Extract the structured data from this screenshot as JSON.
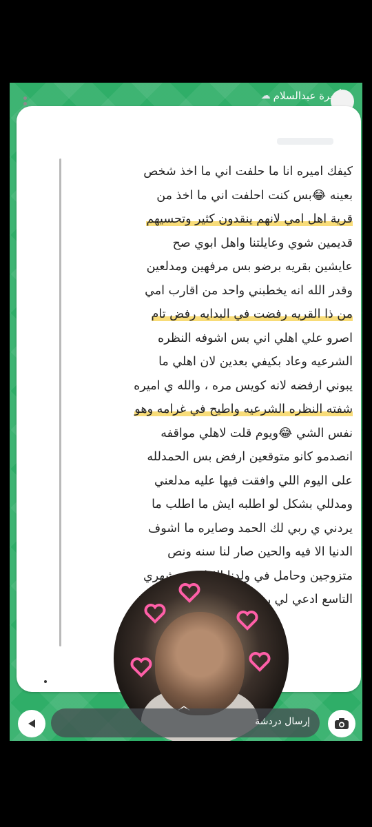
{
  "header": {
    "sender_name": "أميرة عبدالسلام",
    "sender_icon": "cloud-rain-icon"
  },
  "message": {
    "lines": [
      "كيفك اميره انا ما حلفت اني ما اخذ شخص",
      "بعينه 😂بس كنت احلفت اني ما اخذ من",
      "قرية اهل امي لانهم ينقدون كثير وتحسيهم",
      "قديمين شوي وعايلتنا واهل ابوي صح",
      "عايشين بقريه برضو بس مرفهين ومدلعين",
      "وقدر الله انه يخطبني واحد من اقارب امي",
      "من ذا القريه رفضت في البدايه رفض تام",
      "اصرو علي اهلي اني بس اشوفه النظره",
      "الشرعيه وعاد بكيفي بعدين لان اهلي ما",
      "يبوني ارفضه لانه كويس مره ، والله ي اميره",
      "شفته النظره الشرعيه واطيح في غرامه وهو",
      "نفس الشي 😂ويوم قلت لاهلي مواقفه",
      "انصدمو كانو متوقعين ارفض بس الحمدلله",
      "على اليوم اللي وافقت فيها عليه مدلعني",
      "ومدللي بشكل لو اطلبه ايش ما اطلب ما",
      "يردني ي ربي لك الحمد وصايره ما اشوف",
      "الدنيا الا فيه والحين صار لنا سنه ونص",
      "متزوجين وحامل في ولدنا الاول في شهري",
      "التاسع ادعي لي ربي يسهل ولادتي ❤️❤️"
    ]
  },
  "bottom_bar": {
    "chat_placeholder": "إرسال دردشة",
    "camera_icon": "camera-icon",
    "back_icon": "arrow-left-icon"
  },
  "colors": {
    "background": "#2fae68",
    "highlight": "#f7d660",
    "heart": "#ff5fa8"
  }
}
